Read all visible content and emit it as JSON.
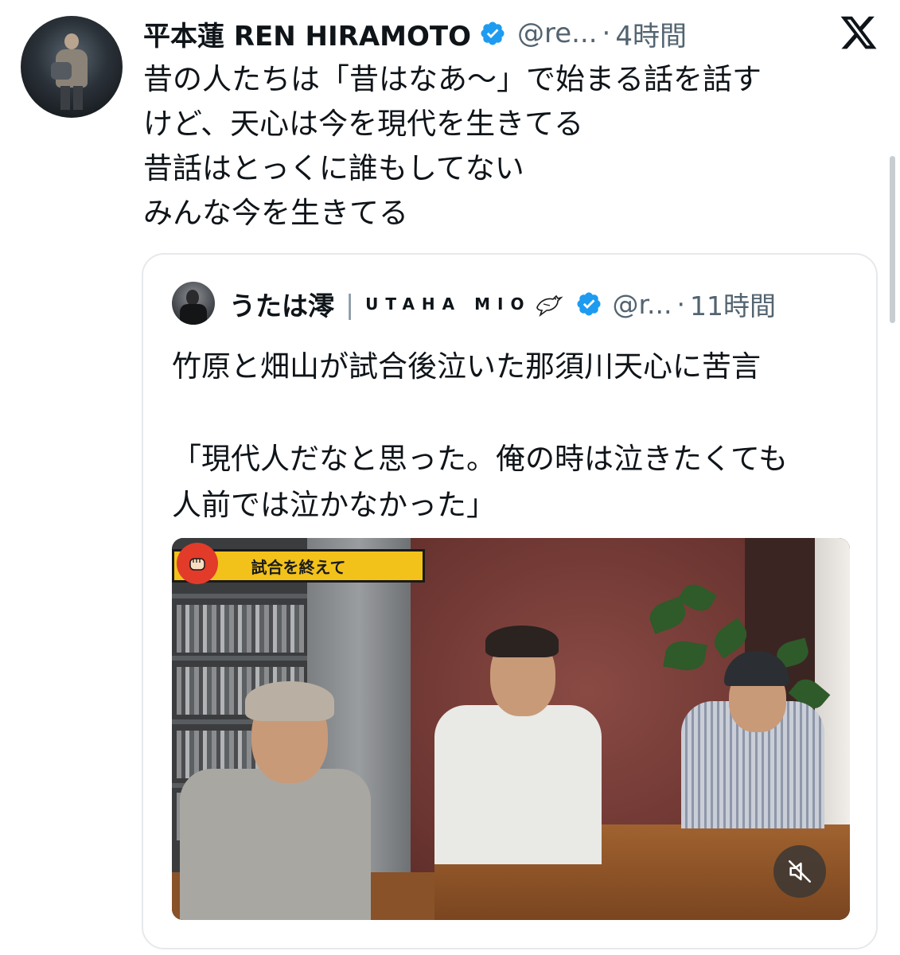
{
  "tweet": {
    "author_name": "平本蓮 REN HIRAMOTO",
    "handle": "@re...",
    "separator": "·",
    "time": "4時間",
    "text_lines": [
      "昔の人たちは「昔はなあ〜」で始まる話を話す",
      "けど、天心は今を現代を生きてる",
      "昔話はとっくに誰もしてない",
      "みんな今を生きてる"
    ]
  },
  "quoted": {
    "author_name": "うたは澪",
    "divider": "|",
    "brand": "UTAHA MIO",
    "handle": "@r...",
    "separator": "·",
    "time": "11時間",
    "text_lines": [
      "竹原と畑山が試合後泣いた那須川天心に苦言",
      "",
      "「現代人だなと思った。俺の時は泣きたくても",
      "人前では泣かなかった」"
    ],
    "media": {
      "banner_text": "試合を終えて",
      "muted": true
    }
  },
  "colors": {
    "verified": "#1d9bf0",
    "secondary_text": "#536471",
    "banner": "#f2c21a"
  },
  "icons": {
    "verified": "verified-badge-icon",
    "x_logo": "x-logo-icon",
    "mute": "speaker-muted-icon",
    "bird": "bird-icon",
    "fist": "fist-icon"
  }
}
